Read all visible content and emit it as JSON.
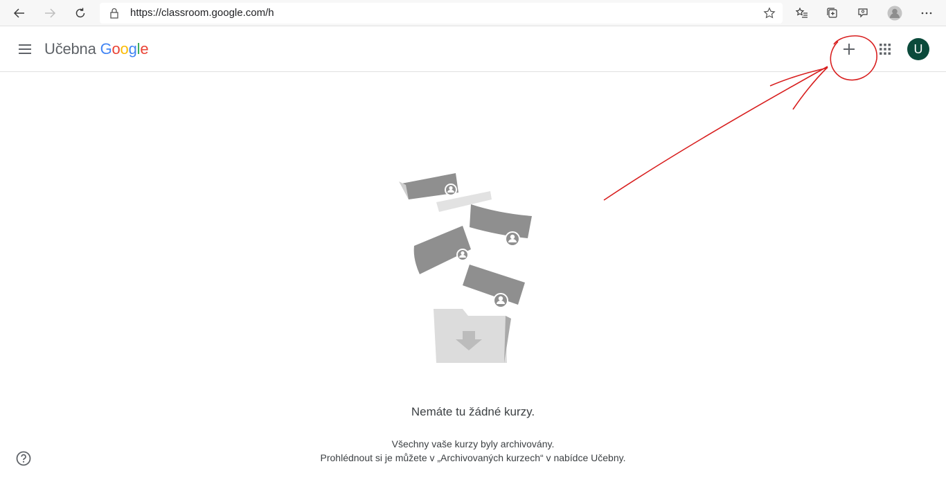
{
  "browser": {
    "url": "https://classroom.google.com/h",
    "icons": [
      "back-icon",
      "forward-icon",
      "reload-icon",
      "lock-icon",
      "favorite-star-icon",
      "favorites-list-icon",
      "collections-icon",
      "feedback-icon",
      "profile-icon",
      "more-icon"
    ]
  },
  "header": {
    "brand_word": "Učebna",
    "brand_google": [
      "G",
      "o",
      "o",
      "g",
      "l",
      "e"
    ],
    "avatar_letter": "U",
    "accent_colors": {
      "blue": "#4285f4",
      "red": "#ea4335",
      "yellow": "#fbbc05",
      "green": "#34a853",
      "avatar_bg": "#0b4a3b",
      "annotation": "#d81e1e"
    }
  },
  "empty_state": {
    "title": "Nemáte tu žádné kurzy.",
    "line1": "Všechny vaše kurzy byly archivovány.",
    "line2": "Prohlédnout si je můžete v „Archivovaných kurzech“ v nabídce Učebny."
  }
}
